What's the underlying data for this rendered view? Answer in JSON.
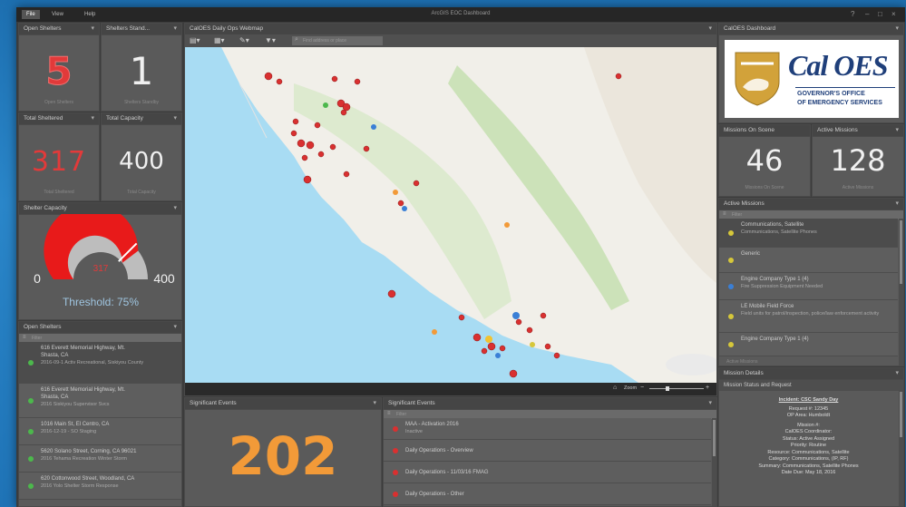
{
  "window": {
    "tabs": [
      "File",
      "View",
      "Help"
    ],
    "title": "ArcGIS EOC Dashboard"
  },
  "open_shelters": {
    "header": "Open Shelters",
    "value": "5",
    "sublabel": "Open Shelters"
  },
  "shelters_stand": {
    "header": "Shelters Stand...",
    "value": "1",
    "sublabel": "Shelters Standby"
  },
  "total_sheltered": {
    "header": "Total Sheltered",
    "value": "317",
    "sublabel": "Total Sheltered"
  },
  "total_capacity": {
    "header": "Total Capacity",
    "value": "400",
    "sublabel": "Total Capacity"
  },
  "shelter_capacity": {
    "header": "Shelter Capacity",
    "min": "0",
    "max": "400",
    "current": "317",
    "fraction": 0.7925,
    "threshold_label": "Threshold: 75%",
    "threshold_fraction": 0.75
  },
  "shelters_list": {
    "header": "Open Shelters",
    "filter": "Filter",
    "items": [
      {
        "line1": "616 Everett Memorial Highway, Mt.",
        "line2": "Shasta, CA",
        "line3": "2016-09-1 Activ Recreational, Siskiyou County",
        "color": "#4cb84c"
      },
      {
        "line1": "616 Everett Memorial Highway, Mt.",
        "line2": "Shasta, CA",
        "line3": "2016 Siskiyou Supervisor Svcs",
        "color": "#4cb84c"
      },
      {
        "line1": "1016 Main St, El Centro, CA",
        "line2": "2016-12-19 - SO Staging",
        "line3": "",
        "color": "#4cb84c"
      },
      {
        "line1": "5620 Solano Street, Corning, CA 96021",
        "line2": "2016 Tehama Recreation Winter Storm",
        "line3": "",
        "color": "#4cb84c"
      },
      {
        "line1": "620 Cottonwood Street, Woodland, CA",
        "line2": "2016 Yolo Shelter Storm Response",
        "line3": "",
        "color": "#4cb84c"
      }
    ]
  },
  "map": {
    "header": "CalOES Daily Ops Webmap",
    "search_placeholder": "Find address or place",
    "zoom_label": "Zoom"
  },
  "sig_events_count": {
    "header": "Significant Events",
    "value": "202"
  },
  "sig_events_list": {
    "header": "Significant Events",
    "filter": "Filter",
    "items": [
      {
        "line1": "MAA - Activation 2016",
        "line2": "Inactive"
      },
      {
        "line1": "Daily Operations - Overview",
        "line2": ""
      },
      {
        "line1": "Daily Operations - 11/03/16 FMAG",
        "line2": ""
      },
      {
        "line1": "Daily Operations - Other",
        "line2": ""
      }
    ]
  },
  "caloes": {
    "header": "CalOES Dashboard",
    "logo_text": "Cal OES",
    "logo_sub1": "GOVERNOR'S OFFICE",
    "logo_sub2": "OF EMERGENCY SERVICES"
  },
  "missions_on_scene": {
    "header": "Missions On Scene",
    "value": "46",
    "sublabel": "Missions On Scene"
  },
  "active_missions": {
    "header": "Active Missions",
    "value": "128",
    "sublabel": "Active Missions"
  },
  "active_missions_list": {
    "header": "Active Missions",
    "filter": "Filter",
    "items": [
      {
        "line1": "Communications, Satellite",
        "line2": "Communications, Satellite Phones",
        "color": "#d6c73a"
      },
      {
        "line1": "Generic",
        "line2": "",
        "color": "#d6c73a"
      },
      {
        "line1": "Engine Company Type 1 (4)",
        "line2": "Fire Suppression Equipment Needed",
        "color": "#3a7fd6"
      },
      {
        "line1": "LE Mobile Field Force",
        "line2": "Field units for patrol/inspection, police/law enforcement activity",
        "color": "#d6c73a"
      },
      {
        "line1": "Engine Company Type 1 (4)",
        "line2": "",
        "color": "#d6c73a"
      }
    ],
    "footer": "Active Missions"
  },
  "mission_details": {
    "header": "Mission Details",
    "subheader": "Mission Status and Request",
    "lines": [
      "Incident: CSC Sandy Day",
      "Request #: 12345",
      "OP Area: Humboldt",
      "Mission #:",
      "CalOES Coordinator:",
      "Status: Active Assigned",
      "Priority: Routine",
      "Resource: Communications, Satellite",
      "Category: Communications, (IP, RF)",
      "Summary: Communications, Satellite Phones",
      "Date Due: May 18, 2016"
    ]
  },
  "colors": {
    "red_number": "#e23a3a",
    "orange_number": "#f29a38",
    "white_number": "#f0f0f0",
    "gauge_red": "#e81a1a"
  },
  "map_markers": [
    {
      "name": "marker-n1",
      "color": "#d93030"
    },
    {
      "name": "marker-n2",
      "color": "#d93030"
    }
  ]
}
